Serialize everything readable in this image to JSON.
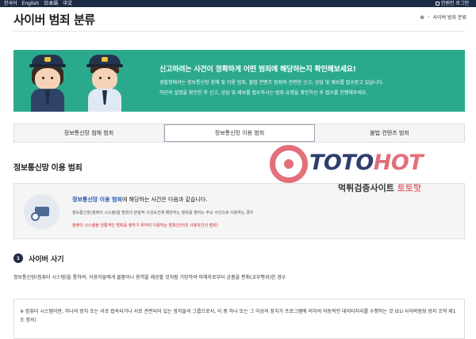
{
  "topbar": {
    "languages": [
      "한국어",
      "English",
      "日本語",
      "中文"
    ],
    "login": "민원인 로그인"
  },
  "header": {
    "title": "사이버 범죄 분류",
    "breadcrumb": {
      "current": "사이버 범죄 분류"
    }
  },
  "banner": {
    "title": "신고하려는 사건이 정확하게 어떤 범죄에 해당하는지 확인해보세요!",
    "line1": "경찰청에서는 정보통신망 침해 및 이용 범죄, 불법 컨텐츠 범죄와 관련한 신고, 상담 및 제보를 접수받고 있습니다.",
    "line2": "하단의 설명을 확인한 후 신고, 상담 및 제보를 접수하시는 범죄 유형을 확인하신 후 접수를 진행해주세요."
  },
  "tabs": [
    {
      "label": "정보통신망 침해 범죄"
    },
    {
      "label": "정보통신망 이용 범죄"
    },
    {
      "label": "불법 컨텐츠 범죄"
    }
  ],
  "watermark": {
    "brand_a": "TOTO",
    "brand_b": "HOT",
    "sub_a": "먹튀검증사이트",
    "sub_b": "토토핫",
    "colors": {
      "navy": "#2e3f6e",
      "pink": "#e2707a"
    }
  },
  "section": {
    "title": "정보통신망 이용 범죄",
    "info": {
      "highlight": "정보통신망 이용 범죄",
      "lead_rest": "에 해당하는 사건은 다음과 같습니다.",
      "text": "정보통신망(컴퓨터 시스템)을 범죄의 본질적 구성요건에 해당하는 행위를 행하는 주요 수단으로 이용하는 경우",
      "warning": "컴퓨터 시스템을 전통적인 범죄를 행하기 위하여 이용하는 범죄(인터넷 사용자간의 범죄)"
    }
  },
  "item1": {
    "number": "1",
    "title": "사이버 사기",
    "text": "정보통신망(컴퓨터 시스템)을 통하여, 이용자들에게 물품이나 용역을 제공할 것처럼 기망하여 피해자로부터 금품을 편취(교부행위)한 경우"
  },
  "note": {
    "text": "※ 컴퓨터 시스템이란, 하나의 장치 또는 서로 접속되거나 서로 관련되어 있는 장치들의 그룹으로서, 이 중 하나 또는 그 이상의 장치가 프로그램에 의하여 자동적인 데이터처리를 수행하는 것 (EU 사이버범죄 방지 조약 제1조 정의)"
  },
  "colors": {
    "banner": "#2ba98d",
    "topbar": "#1d2c46",
    "highlight": "#1f56b0",
    "warning": "#d32525"
  }
}
